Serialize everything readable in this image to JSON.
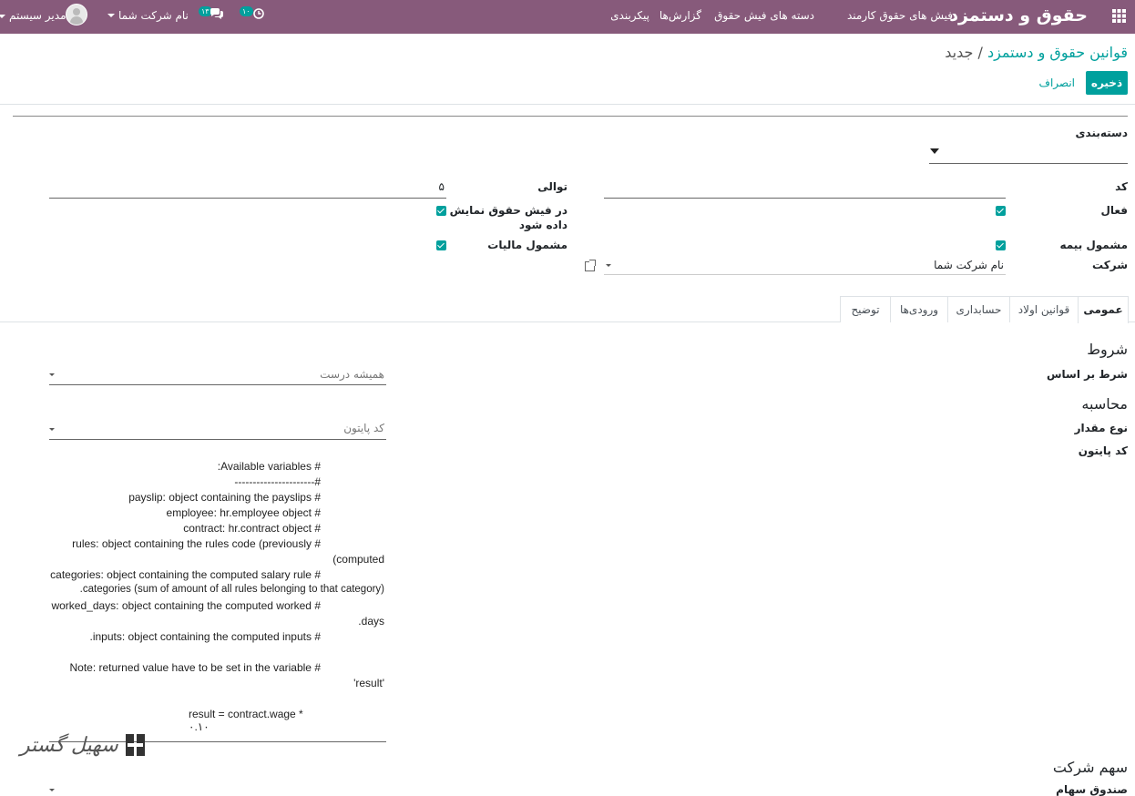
{
  "navbar": {
    "app_title": "حقوق و دستمزد",
    "menu": [
      "فیش های حقوق کارمند",
      "دسته های فیش حقوق",
      "گزارش‌ها",
      "پیکربندی"
    ],
    "activity_count": "۱۰",
    "messages_count": "۱۳",
    "company": "نام شرکت شما",
    "user": "مدیر سیستم"
  },
  "breadcrumb": {
    "parent": "قوانین حقوق و دستمزد",
    "separator": "/",
    "current": "جدید"
  },
  "buttons": {
    "save": "ذخیره",
    "discard": "انصراف"
  },
  "form": {
    "category_label": "دسته‌بندی",
    "category_value": "",
    "code_label": "کد",
    "code_value": "",
    "sequence_label": "توالی",
    "sequence_value": "۵",
    "active_label": "فعال",
    "active_checked": true,
    "appears_line1": "در فیش حقوق نمایش",
    "appears_line2": "داده شود",
    "appears_checked": true,
    "insurance_label": "مشمول بیمه",
    "insurance_checked": true,
    "tax_label": "مشمول مالیات",
    "tax_checked": true,
    "company_label": "شرکت",
    "company_value": "نام شرکت شما"
  },
  "tabs": [
    "عمومی",
    "قوانین اولاد",
    "حسابداری",
    "ورودی‌ها",
    "توضیح"
  ],
  "general": {
    "conditions_title": "شروط",
    "condition_based_label": "شرط بر اساس",
    "condition_based_value": "همیشه درست",
    "computation_title": "محاسبه",
    "amount_type_label": "نوع مقدار",
    "amount_type_value": "کد پایتون",
    "python_code_label": "کد پایتون",
    "code_lines": [
      "# Available variables:",
      "#----------------------",
      "# payslip: object containing the payslips",
      "# employee: hr.employee object",
      "# contract: hr.contract object",
      "# rules: object containing the rules code (previously",
      "computed)",
      "# categories: object containing the computed salary rule",
      "categories (sum of amount of all rules belonging to that category).",
      "# worked_days: object containing the computed worked",
      "days.",
      "# inputs: object containing the computed inputs.",
      "",
      "# Note: returned value have to be set in the variable",
      "'result'",
      "",
      "result = contract.wage * ۰.۱۰"
    ],
    "company_contribution_title": "سهم شرکت",
    "partner_label": "صندوق سهام"
  },
  "watermark": "سهیل گستر"
}
